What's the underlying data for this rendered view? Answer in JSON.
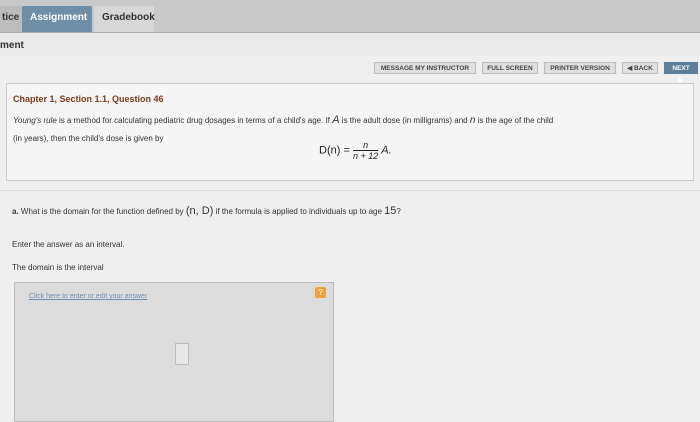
{
  "tabs": [
    {
      "label": "tice"
    },
    {
      "label": "Assignment"
    },
    {
      "label": "Gradebook"
    }
  ],
  "page_subtitle": "ment",
  "toolbar": {
    "message": "MESSAGE MY INSTRUCTOR",
    "fullscreen": "FULL SCREEN",
    "printer": "PRINTER VERSION",
    "back": "◀ BACK",
    "next": "NEXT ▶"
  },
  "question": {
    "title": "Chapter 1, Section 1.1, Question 46",
    "text_line1_a": "Young's rule",
    "text_line1_b": " is a method for calculating pediatric drug dosages in terms of a child's age. If ",
    "var_A": "A",
    "text_line1_c": " is the adult dose (in milligrams) and ",
    "var_n": "n",
    "text_line1_d": " is the age of the child",
    "text_line2": "(in years), then the child's dose is given by",
    "formula_lhs": "D(n) = ",
    "formula_num": "n",
    "formula_den": "n + 12",
    "formula_rhs": "A."
  },
  "part_a": {
    "label": "a.",
    "text1": " What is the domain for the function defined by ",
    "nd": "(n, D)",
    "text2": " if the formula is applied to individuals up to age ",
    "age": "15",
    "qmark": "?"
  },
  "instruction": "Enter the answer as an interval.",
  "prompt": "The domain is the interval",
  "answer": {
    "hint": "Click here to enter or edit your answer",
    "help": "?"
  }
}
